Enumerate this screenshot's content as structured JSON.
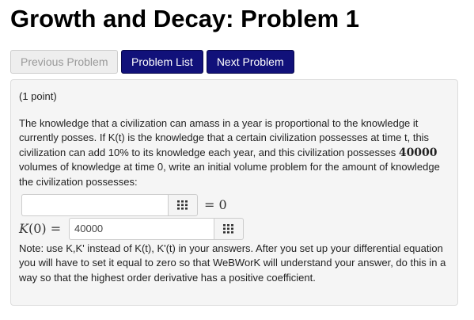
{
  "page": {
    "title": "Growth and Decay: Problem 1"
  },
  "nav": {
    "previous_label": "Previous Problem",
    "list_label": "Problem List",
    "next_label": "Next Problem"
  },
  "problem": {
    "points": "(1 point)",
    "text_before_num": "The knowledge that a civilization can amass in a year is proportional to the knowledge it currently posses. If K(t) is the knowledge that a certain civilization possesses at time t, this civilization can add 10% to its knowledge each year, and this civilization possesses ",
    "highlight_num": "40000",
    "text_after_num": " volumes of knowledge at time 0, write an initial volume problem for the amount of knowledge the civilization possesses:",
    "answer1": {
      "value": "",
      "equals_text": "= 0",
      "icon": "grid-icon"
    },
    "answer2": {
      "label_var": "K",
      "label_rest": "(0) =",
      "value": "40000",
      "icon": "grid-icon"
    },
    "note": "Note: use K,K' instead of K(t), K'(t) in your answers. After you set up your differential equation you will have to set it equal to zero so that WeBWorK will understand your answer, do this in a way so that the highest order derivative has a positive coefficient."
  },
  "colors": {
    "primary_button": "#11117a",
    "disabled_button": "#eeeeee",
    "panel_bg": "#f5f5f5"
  }
}
